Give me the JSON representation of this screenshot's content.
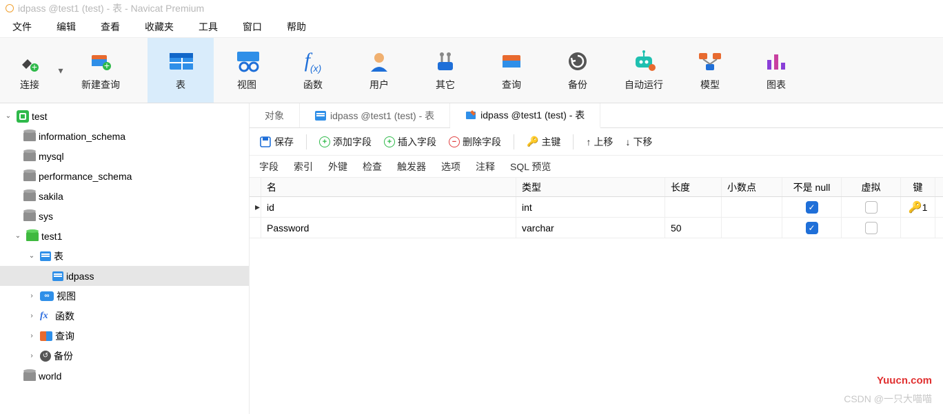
{
  "titlebar": "idpass @test1 (test) - 表 - Navicat Premium",
  "menu": [
    "文件",
    "编辑",
    "查看",
    "收藏夹",
    "工具",
    "窗口",
    "帮助"
  ],
  "ribbon": [
    {
      "k": "connect",
      "label": "连接"
    },
    {
      "k": "newquery",
      "label": "新建查询"
    },
    {
      "k": "table",
      "label": "表"
    },
    {
      "k": "view",
      "label": "视图"
    },
    {
      "k": "func",
      "label": "函数"
    },
    {
      "k": "user",
      "label": "用户"
    },
    {
      "k": "other",
      "label": "其它"
    },
    {
      "k": "query",
      "label": "查询"
    },
    {
      "k": "backup",
      "label": "备份"
    },
    {
      "k": "auto",
      "label": "自动运行"
    },
    {
      "k": "model",
      "label": "模型"
    },
    {
      "k": "chart",
      "label": "图表"
    }
  ],
  "tree": {
    "conn": "test",
    "dbs": [
      "information_schema",
      "mysql",
      "performance_schema",
      "sakila",
      "sys"
    ],
    "activeDb": "test1",
    "tableGroup": "表",
    "tableItem": "idpass",
    "others": [
      {
        "k": "view",
        "label": "视图"
      },
      {
        "k": "func",
        "label": "函数"
      },
      {
        "k": "query",
        "label": "查询"
      },
      {
        "k": "backup",
        "label": "备份"
      }
    ],
    "lastDb": "world"
  },
  "tabs": [
    {
      "label": "对象"
    },
    {
      "label": "idpass @test1 (test) - 表"
    },
    {
      "label": "idpass @test1 (test) - 表"
    }
  ],
  "toolbar": {
    "save": "保存",
    "add": "添加字段",
    "insert": "插入字段",
    "delete": "删除字段",
    "pkey": "主键",
    "up": "上移",
    "down": "下移"
  },
  "subtabs": [
    "字段",
    "索引",
    "外键",
    "检查",
    "触发器",
    "选项",
    "注释",
    "SQL 预览"
  ],
  "grid": {
    "head": {
      "name": "名",
      "type": "类型",
      "len": "长度",
      "dec": "小数点",
      "null": "不是 null",
      "virt": "虚拟",
      "key": "键"
    },
    "rows": [
      {
        "name": "id",
        "type": "int",
        "len": "",
        "dec": "",
        "notnull": true,
        "virtual": false,
        "key": true,
        "current": true
      },
      {
        "name": "Password",
        "type": "varchar",
        "len": "50",
        "dec": "",
        "notnull": true,
        "virtual": false,
        "key": false,
        "current": false
      }
    ]
  },
  "watermark1": "Yuucn.com",
  "watermark2": "CSDN @一只大喵喵"
}
